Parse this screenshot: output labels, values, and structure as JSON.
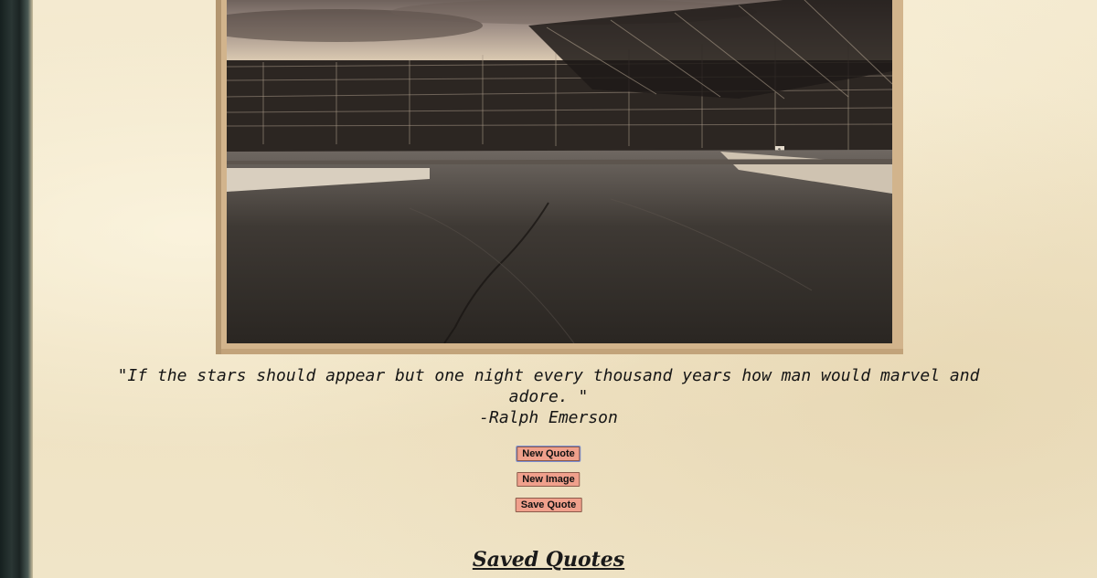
{
  "quote": {
    "text": "\"If the stars should appear but one night every thousand years how man would marvel and adore. \"",
    "author": "-Ralph Emerson"
  },
  "buttons": {
    "new_quote": "New Quote",
    "new_image": "New Image",
    "save_quote": "Save Quote"
  },
  "saved_quotes": {
    "title": "Saved Quotes"
  },
  "photo": {
    "subject": "empty racetrack with grandstands, sepia tone",
    "sign_number": "1"
  },
  "colors": {
    "paper": "#efe3c6",
    "frame": "#d2b48c",
    "button_bg": "#f0a08c",
    "button_border": "#8b5a4a",
    "focus_ring": "#7b8fd4"
  }
}
